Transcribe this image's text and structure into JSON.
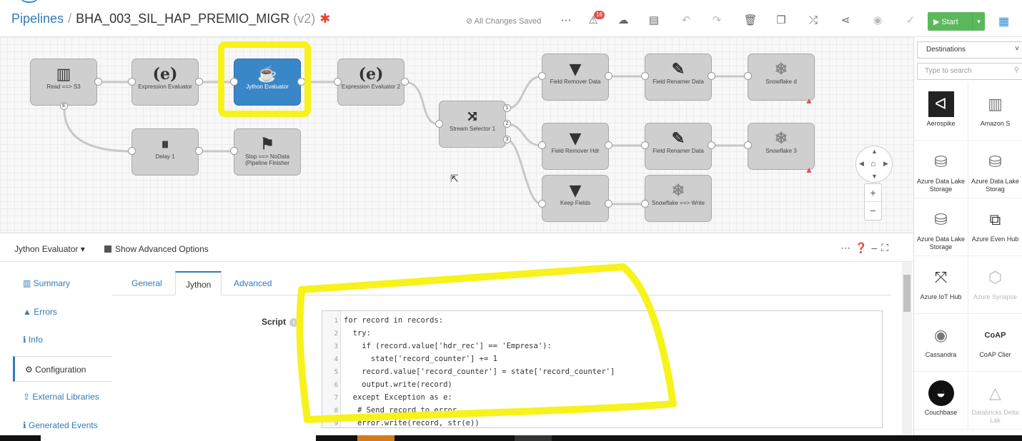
{
  "header": {
    "breadcrumb_root": "Pipelines",
    "separator": "/",
    "pipeline_name": "BHA_003_SIL_HAP_PREMIO_MIGR",
    "version": "(v2)",
    "modified_marker": "✱",
    "save_status": "⊘ All Changes Saved",
    "alert_count": "16",
    "start_label": "▶ Start"
  },
  "nodes": {
    "read": "Read ==> S3",
    "expr1": "Expression Evaluator",
    "jython": "Jython Evaluator",
    "expr2": "Expression Evaluator 2",
    "selector": "Stream Selector 1",
    "frd": "Field Remover Data",
    "frnd": "Field Renamer Data",
    "snowd": "Snowflake d",
    "frh": "Field Remover Hdr",
    "frnh": "Field Renamer Data",
    "snow3": "Snowflake 3",
    "keep": "Keep Fields",
    "snoww": "Snowflake ==> Write",
    "delay": "Delay 1",
    "stop": "Stop ==> NoData (Pipeline Finisher"
  },
  "ports": {
    "e": "E",
    "p1": "1",
    "p2": "2",
    "p3": "3"
  },
  "palette": {
    "dropdown": "Destinations",
    "search_placeholder": "Type to search",
    "items": [
      "Aerospike",
      "Amazon S",
      "Azure Data Lake Storage",
      "Azure Data Lake Storag",
      "Azure Data Lake Storage",
      "Azure Even Hub",
      "Azure IoT Hub",
      "Azure Synapse",
      "Cassandra",
      "CoAP Clier",
      "Couchbase",
      "Databricks Delta Lak"
    ]
  },
  "panel": {
    "stage_name": "Jython Evaluator ▾",
    "advanced_label": "Show Advanced Options",
    "nav": [
      "Summary",
      "Errors",
      "Info",
      "Configuration",
      "External Libraries",
      "Generated Events"
    ],
    "tabs": [
      "General",
      "Jython",
      "Advanced"
    ],
    "script_label": "Script"
  },
  "code": [
    "for record in records:",
    "  try:",
    "    if (record.value['hdr_rec'] == 'Empresa'):",
    "      state['record_counter'] += 1",
    "    record.value['record_counter'] = state['record_counter']",
    "    output.write(record)",
    "  except Exception as e:",
    "   # Send record to error",
    "   error.write(record, str(e))"
  ],
  "colors": {
    "accent": "#337ab7",
    "selected_stage": "#3a87c8",
    "start": "#5cb85c",
    "highlight": "#f7f21b",
    "warning": "#d9534f"
  }
}
